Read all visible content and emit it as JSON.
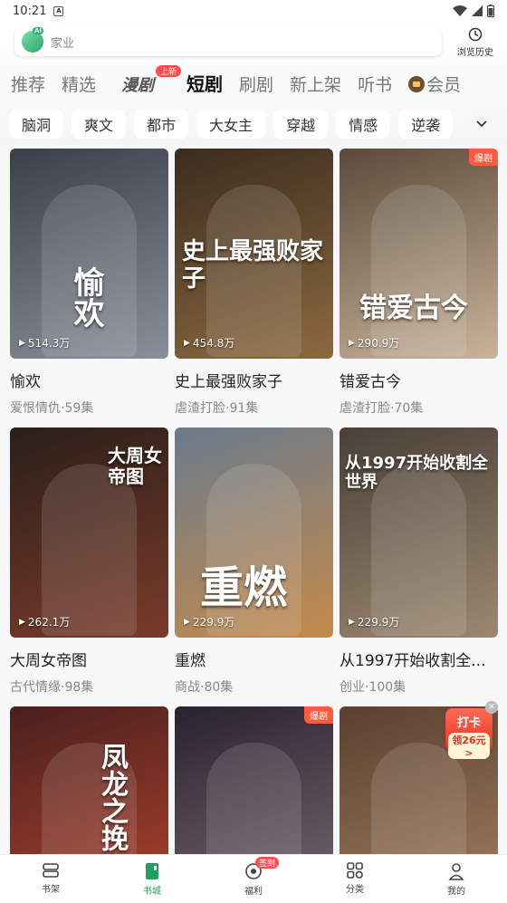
{
  "status_bar": {
    "time": "10:21"
  },
  "search": {
    "placeholder": "家业",
    "ai_tag": "AI"
  },
  "history": {
    "label": "浏览历史"
  },
  "tabs": [
    {
      "label": "推荐"
    },
    {
      "label": "精选"
    },
    {
      "label": "漫剧",
      "badge": "上新"
    },
    {
      "label": "短剧",
      "active": true
    },
    {
      "label": "刷剧"
    },
    {
      "label": "新上架"
    },
    {
      "label": "听书"
    },
    {
      "label": "会员"
    }
  ],
  "chips": [
    "脑洞",
    "爽文",
    "都市",
    "大女主",
    "穿越",
    "情感",
    "逆袭"
  ],
  "cards": [
    {
      "title": "愉欢",
      "poster_text": "愉欢",
      "meta": "爱恨情仇·59集",
      "plays": "514.3万",
      "colors": [
        "#3a3f4a",
        "#8a8f99"
      ]
    },
    {
      "title": "史上最强败家子",
      "poster_text": "史上最强败家子",
      "meta": "虐渣打脸·91集",
      "plays": "454.8万",
      "colors": [
        "#3b2c1e",
        "#8c6a3f"
      ]
    },
    {
      "title": "错爱古今",
      "poster_text": "错爱古今",
      "meta": "虐渣打脸·70集",
      "plays": "290.9万",
      "badge": "爆剧",
      "colors": [
        "#5b4a3b",
        "#c9b49a"
      ]
    },
    {
      "title": "大周女帝图",
      "poster_text": "大周女帝图",
      "meta": "古代情缘·98集",
      "plays": "262.1万",
      "colors": [
        "#2a1f1a",
        "#7a3b2a"
      ]
    },
    {
      "title": "重燃",
      "poster_text": "重燃",
      "meta": "商战·80集",
      "plays": "229.9万",
      "colors": [
        "#6a7b8c",
        "#c58a4a"
      ]
    },
    {
      "title": "从1997开始收割全...",
      "poster_text": "从1997开始收割全世界",
      "meta": "创业·100集",
      "plays": "229.9万",
      "colors": [
        "#4a4038",
        "#9c8870"
      ]
    },
    {
      "title": "",
      "poster_text": "凤龙之挽",
      "meta": "",
      "plays": "",
      "colors": [
        "#4a1f1f",
        "#b0442c"
      ]
    },
    {
      "title": "",
      "poster_text": "",
      "meta": "",
      "plays": "",
      "badge": "爆剧",
      "colors": [
        "#2a2230",
        "#7b6a70"
      ]
    },
    {
      "title": "",
      "poster_text": "",
      "meta": "",
      "plays": "",
      "colors": [
        "#5a4030",
        "#a38060"
      ]
    }
  ],
  "checkin": {
    "title": "打卡",
    "reward": "领26元>"
  },
  "bottom_nav": [
    {
      "label": "书架"
    },
    {
      "label": "书城",
      "active": true
    },
    {
      "label": "福利",
      "badge": "签到"
    },
    {
      "label": "分类"
    },
    {
      "label": "我的"
    }
  ]
}
